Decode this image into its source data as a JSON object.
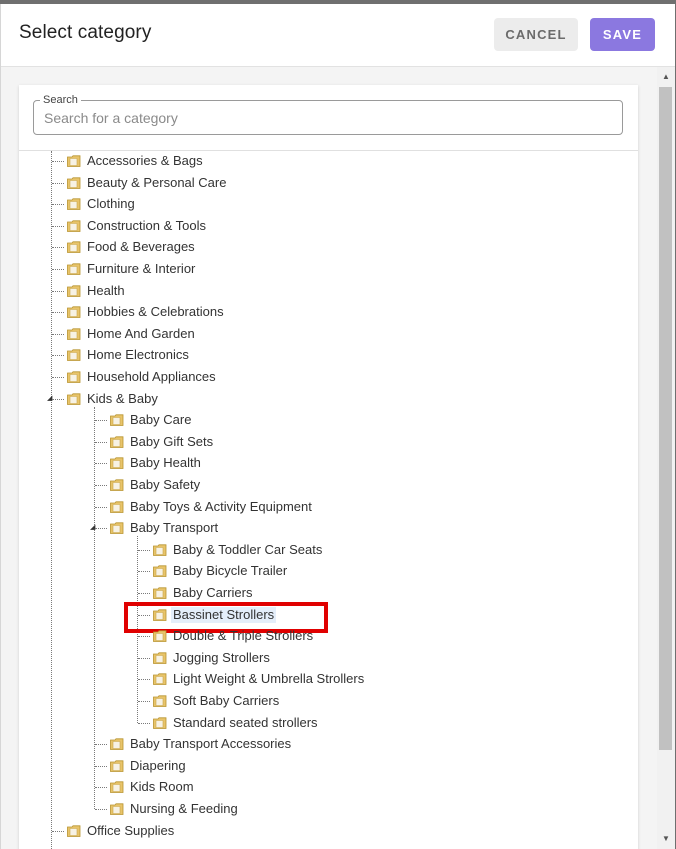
{
  "dialog": {
    "title": "Select category",
    "cancel_label": "CANCEL",
    "save_label": "SAVE"
  },
  "search": {
    "legend": "Search",
    "placeholder": "Search for a category",
    "value": ""
  },
  "tree": {
    "level0": [
      "Accessories & Bags",
      "Beauty & Personal Care",
      "Clothing",
      "Construction & Tools",
      "Food & Beverages",
      "Furniture & Interior",
      "Health",
      "Hobbies & Celebrations",
      "Home And Garden",
      "Home Electronics",
      "Household Appliances",
      "Kids & Baby",
      "Office Supplies"
    ],
    "kids_baby_children": [
      "Baby Care",
      "Baby Gift Sets",
      "Baby Health",
      "Baby Safety",
      "Baby Toys & Activity Equipment",
      "Baby Transport",
      "Baby Transport Accessories",
      "Diapering",
      "Kids Room",
      "Nursing & Feeding"
    ],
    "baby_transport_children": [
      "Baby & Toddler Car Seats",
      "Baby Bicycle Trailer",
      "Baby Carriers",
      "Bassinet Strollers",
      "Double & Triple Strollers",
      "Jogging Strollers",
      "Light Weight & Umbrella Strollers",
      "Soft Baby Carriers",
      "Standard seated strollers"
    ],
    "selected": "Bassinet Strollers",
    "expanded": [
      "Kids & Baby",
      "Baby Transport"
    ]
  },
  "colors": {
    "accent": "#8b78e0",
    "highlight": "#e00000",
    "folder": "#e8c46a"
  },
  "icons": {
    "folder": "folder-icon",
    "expanded": "expanded-triangle-icon",
    "collapsed": "collapsed-node-icon"
  }
}
